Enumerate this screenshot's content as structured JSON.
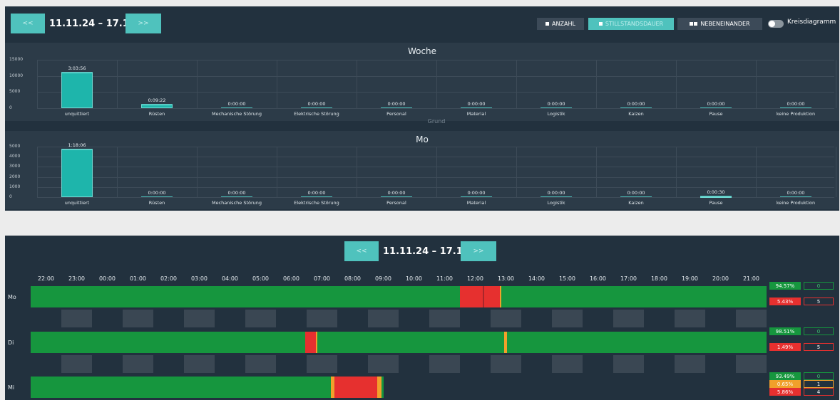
{
  "top": {
    "prev_label": "<<",
    "next_label": ">>",
    "date_range": "11.11.24 – 17.11.24",
    "toggles": [
      {
        "label": "ANZAHL",
        "active": false
      },
      {
        "label": "STILLSTANDSDAUER",
        "active": true
      },
      {
        "label": "NEBENEINANDER",
        "active": false
      }
    ],
    "pie_toggle_label": "Kreisdiagramm",
    "pie_toggle_on": false
  },
  "categories": [
    "unquittiert",
    "Rüsten",
    "Mechanische Störung",
    "Elektrische Störung",
    "Personal",
    "Material",
    "Logistik",
    "Kaizen",
    "Pause",
    "keine Produktion"
  ],
  "charts": [
    {
      "title": "Woche",
      "yticks": [
        "15000",
        "10000",
        "5000",
        "0"
      ],
      "ymax": 15000,
      "values": [
        11036,
        1162,
        0,
        0,
        0,
        0,
        0,
        0,
        0,
        0
      ],
      "labels": [
        "3:03:56",
        "0:09:22",
        "0:00:00",
        "0:00:00",
        "0:00:00",
        "0:00:00",
        "0:00:00",
        "0:00:00",
        "0:00:00",
        "0:00:00"
      ],
      "xlabel": "Grund"
    },
    {
      "title": "Mo",
      "yticks": [
        "5000",
        "4000",
        "3000",
        "2000",
        "1000",
        "0"
      ],
      "ymax": 5000,
      "values": [
        4686,
        0,
        0,
        0,
        0,
        0,
        0,
        0,
        30,
        0
      ],
      "labels": [
        "1:18:06",
        "0:00:00",
        "0:00:00",
        "0:00:00",
        "0:00:00",
        "0:00:00",
        "0:00:00",
        "0:00:00",
        "0:00:30",
        "0:00:00"
      ]
    }
  ],
  "timeline": {
    "date_range": "11.11.24 – 17.11.24",
    "prev_label": "<<",
    "next_label": ">>",
    "hours": [
      "22:00",
      "23:00",
      "00:00",
      "01:00",
      "02:00",
      "03:00",
      "04:00",
      "05:00",
      "06:00",
      "07:00",
      "08:00",
      "09:00",
      "10:00",
      "11:00",
      "12:00",
      "13:00",
      "14:00",
      "15:00",
      "16:00",
      "17:00",
      "18:00",
      "19:00",
      "20:00",
      "21:00"
    ],
    "colors": {
      "run": "#16963e",
      "stop": "#e6302f",
      "warn": "#f1a02b",
      "dark": "#a8262a"
    },
    "rows": [
      {
        "day": "Mo",
        "end": 24,
        "segments": [
          {
            "start": 14.0,
            "end": 14.75,
            "type": "stop"
          },
          {
            "start": 14.75,
            "end": 14.8,
            "type": "dark"
          },
          {
            "start": 14.8,
            "end": 15.3,
            "type": "stop"
          },
          {
            "start": 15.3,
            "end": 15.35,
            "type": "warn"
          }
        ],
        "stats": [
          {
            "pct": "94.57%",
            "count": "0",
            "type": "run"
          },
          {
            "pct": "5.43%",
            "count": "5",
            "type": "stop"
          }
        ]
      },
      {
        "day": "Di",
        "end": 24,
        "segments": [
          {
            "start": 8.95,
            "end": 9.3,
            "type": "stop"
          },
          {
            "start": 9.3,
            "end": 9.36,
            "type": "warn"
          },
          {
            "start": 15.45,
            "end": 15.53,
            "type": "warn"
          }
        ],
        "stats": [
          {
            "pct": "98.51%",
            "count": "0",
            "type": "run"
          },
          {
            "pct": "1.49%",
            "count": "5",
            "type": "stop"
          }
        ]
      },
      {
        "day": "Mi",
        "end": 11.5,
        "segments": [
          {
            "start": 9.8,
            "end": 9.9,
            "type": "warn"
          },
          {
            "start": 9.9,
            "end": 11.3,
            "type": "stop"
          },
          {
            "start": 11.3,
            "end": 11.45,
            "type": "warn"
          }
        ],
        "stats": [
          {
            "pct": "93.49%",
            "count": "0",
            "type": "run"
          },
          {
            "pct": "0.65%",
            "count": "1",
            "type": "warn"
          },
          {
            "pct": "5.86%",
            "count": "4",
            "type": "stop"
          }
        ]
      }
    ]
  }
}
